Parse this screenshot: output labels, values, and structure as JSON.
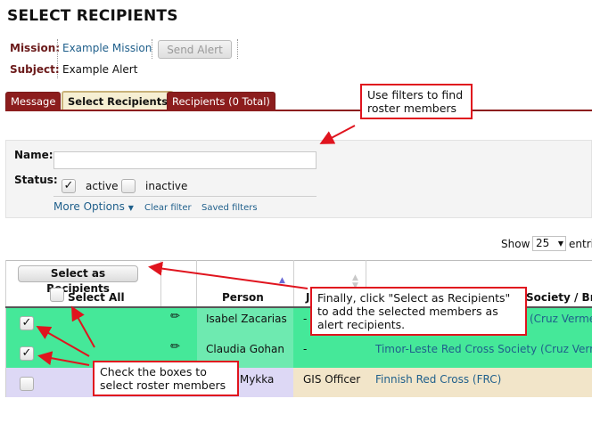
{
  "page_title": "SELECT RECIPIENTS",
  "mission": {
    "label": "Mission:",
    "value": "Example Mission"
  },
  "subject": {
    "label": "Subject:",
    "value": "Example Alert"
  },
  "send_alert_label": "Send Alert",
  "tabs": [
    {
      "label": "Message",
      "active": false
    },
    {
      "label": "Select Recipients",
      "active": true
    },
    {
      "label": "Recipients (0 Total)",
      "active": false
    }
  ],
  "filters": {
    "name_label": "Name:",
    "name_value": "",
    "status_label": "Status:",
    "active_label": "active",
    "active_checked": true,
    "inactive_label": "inactive",
    "inactive_checked": false,
    "more_options_label": "More Options",
    "clear_filter_label": "Clear filter",
    "saved_filters_label": "Saved filters"
  },
  "show_entries": {
    "show_label": "Show",
    "value": "25",
    "entries_label": "entri"
  },
  "table": {
    "select_as_recipients_label": "Select as Recipients",
    "select_all_label": "Select All",
    "headers": {
      "person": "Person",
      "job_title": "J",
      "society": "Society / Bra"
    },
    "rows": [
      {
        "checked": true,
        "person": "Isabel Zacarias",
        "job_title": "-",
        "society": "(Cruz Verme"
      },
      {
        "checked": true,
        "person": "Claudia Gohan",
        "job_title": "-",
        "society": "Timor-Leste Red Cross Society (Cruz Verme"
      },
      {
        "checked": false,
        "person": "...nen Mykka",
        "job_title": "GIS Officer",
        "society": "Finnish Red Cross (FRC)"
      }
    ]
  },
  "callouts": {
    "filters": [
      "Use filters to find",
      "roster members"
    ],
    "finally": [
      "Finally, click \"Select as Recipients\"",
      "to add the selected members as",
      "alert recipients."
    ],
    "check": [
      "Check the boxes to",
      "select roster members"
    ]
  },
  "icons": {
    "checkmark": "check-icon",
    "edit": "pencil-icon",
    "sort": "sort-icon",
    "dropdown": "chevron-down-icon"
  },
  "colors": {
    "brand": "#8c1d1d",
    "callout_border": "#e0141e",
    "row_selected": "#45e899",
    "row_unselected": "#ddd8f5",
    "society_bg": "#f2e5c9"
  }
}
